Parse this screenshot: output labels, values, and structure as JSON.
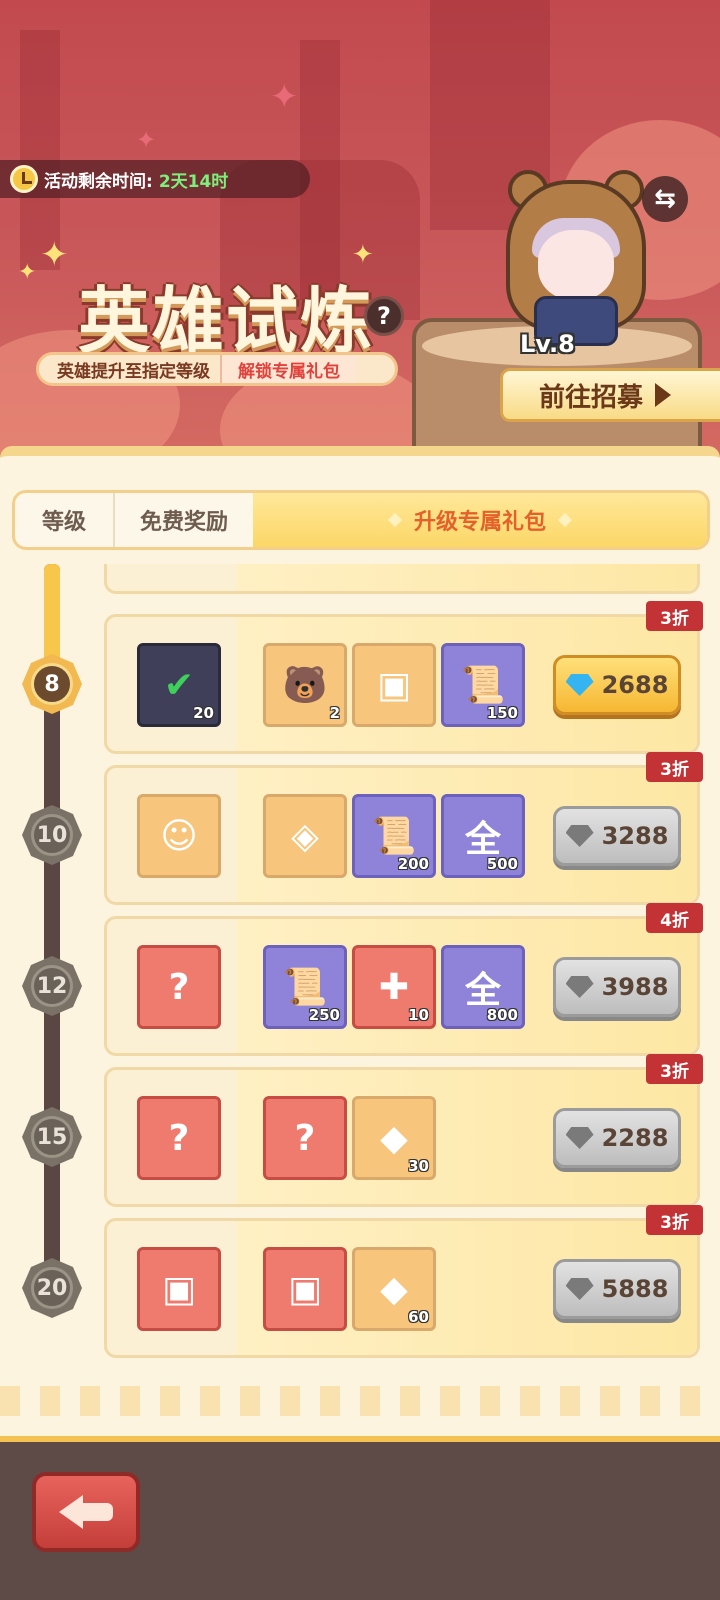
{
  "banner": {
    "timer_label": "活动剩余时间:",
    "timer_value": "2天14时",
    "title": "英雄试炼",
    "help": "?",
    "subtitle_left": "英雄提升至指定等级",
    "subtitle_right": "解锁专属礼包",
    "hero_level": "Lv.8",
    "swap_symbol": "⇆",
    "recruit_label": "前往招募"
  },
  "tabs": [
    {
      "label": "等级",
      "active": false
    },
    {
      "label": "免费奖励",
      "active": false
    },
    {
      "label": "升级专属礼包",
      "active": true
    }
  ],
  "rows": [
    {
      "level": "8",
      "active": true,
      "discount": "3折",
      "price": "2688",
      "price_style": "gold",
      "claimed_item": {
        "icon": "integral-book-checked-icon",
        "qty": "20"
      },
      "items": [
        {
          "icon": "bear-hood-hero-icon",
          "qty": "2",
          "bg": "orange"
        },
        {
          "icon": "treasure-chest-icon",
          "qty": "",
          "bg": "orange"
        },
        {
          "icon": "integral-scroll-icon",
          "qty": "150",
          "bg": "purple"
        }
      ]
    },
    {
      "level": "10",
      "active": false,
      "discount": "3折",
      "price": "3288",
      "price_style": "gray",
      "claimed_item": {
        "icon": "hero-team-portrait-icon",
        "qty": ""
      },
      "items": [
        {
          "icon": "magic-chest-icon",
          "qty": "",
          "bg": "orange"
        },
        {
          "icon": "integral-scroll-icon",
          "qty": "200",
          "bg": "purple"
        },
        {
          "icon": "all-orb-icon",
          "qty": "500",
          "bg": "purple",
          "glyph": "全"
        }
      ]
    },
    {
      "level": "12",
      "active": false,
      "discount": "4折",
      "price": "3988",
      "price_style": "gray",
      "claimed_item": {
        "icon": "mystery-card-icon",
        "qty": ""
      },
      "items": [
        {
          "icon": "integral-scroll-icon",
          "qty": "250",
          "bg": "purple"
        },
        {
          "icon": "puzzle-piece-icon",
          "qty": "10",
          "bg": "red"
        },
        {
          "icon": "all-orb-icon",
          "qty": "800",
          "bg": "purple",
          "glyph": "全"
        }
      ]
    },
    {
      "level": "15",
      "active": false,
      "discount": "3折",
      "price": "2288",
      "price_style": "gray",
      "claimed_item": {
        "icon": "mystery-card-icon",
        "qty": ""
      },
      "items": [
        {
          "icon": "mystery-gift-box-icon",
          "qty": "",
          "bg": "red"
        },
        {
          "icon": "amber-crystal-icon",
          "qty": "30",
          "bg": "orange"
        }
      ]
    },
    {
      "level": "20",
      "active": false,
      "discount": "3折",
      "price": "5888",
      "price_style": "gray",
      "claimed_item": {
        "icon": "red-treasure-chest-icon",
        "qty": ""
      },
      "items": [
        {
          "icon": "orange-treasure-chest-icon",
          "qty": "",
          "bg": "red"
        },
        {
          "icon": "amber-crystal-icon",
          "qty": "60",
          "bg": "orange"
        }
      ]
    }
  ],
  "colors": {
    "gem_blue": "#34b4f0",
    "gem_gray": "#7a7a7a",
    "discount_red": "#c33335",
    "accent_orange": "#e3612a"
  },
  "bottom": {
    "back_icon": "arrow-left-icon"
  }
}
